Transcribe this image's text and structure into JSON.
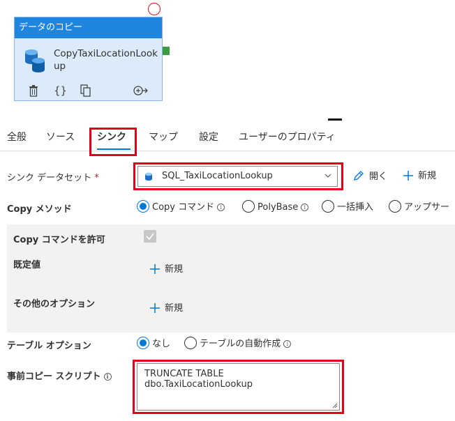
{
  "activity": {
    "header": "データのコピー",
    "name": "CopyTaxiLocationLookup"
  },
  "tabs": [
    {
      "label": "全般",
      "active": false
    },
    {
      "label": "ソース",
      "active": false
    },
    {
      "label": "シンク",
      "active": true
    },
    {
      "label": "マップ",
      "active": false
    },
    {
      "label": "設定",
      "active": false
    },
    {
      "label": "ユーザーのプロパティ",
      "active": false
    }
  ],
  "sink": {
    "dataset_label": "シンク データセット",
    "required_mark": "*",
    "dataset_value": "SQL_TaxiLocationLookup",
    "open_label": "開く",
    "new_label": "新規"
  },
  "copy_method": {
    "label": "Copy メソッド",
    "options": [
      "Copy コマンド",
      "PolyBase",
      "一括挿入",
      "アップサー"
    ],
    "selected": "Copy コマンド"
  },
  "copy_command": {
    "allow_label": "Copy コマンドを許可",
    "allow_checked": true,
    "defaults_label": "既定値",
    "defaults_new": "新規",
    "other_options_label": "その他のオプション",
    "other_options_new": "新規"
  },
  "table_option": {
    "label": "テーブル オプション",
    "options": [
      "なし",
      "テーブルの自動作成"
    ],
    "selected": "なし"
  },
  "pre_copy_script": {
    "label": "事前コピー スクリプト",
    "value": "TRUNCATE TABLE dbo.TaxiLocationLookup"
  },
  "colors": {
    "accent": "#0078d4",
    "header_blue": "#1f86e0",
    "highlight_red": "#e3001b",
    "port_green": "#3d9b43"
  }
}
